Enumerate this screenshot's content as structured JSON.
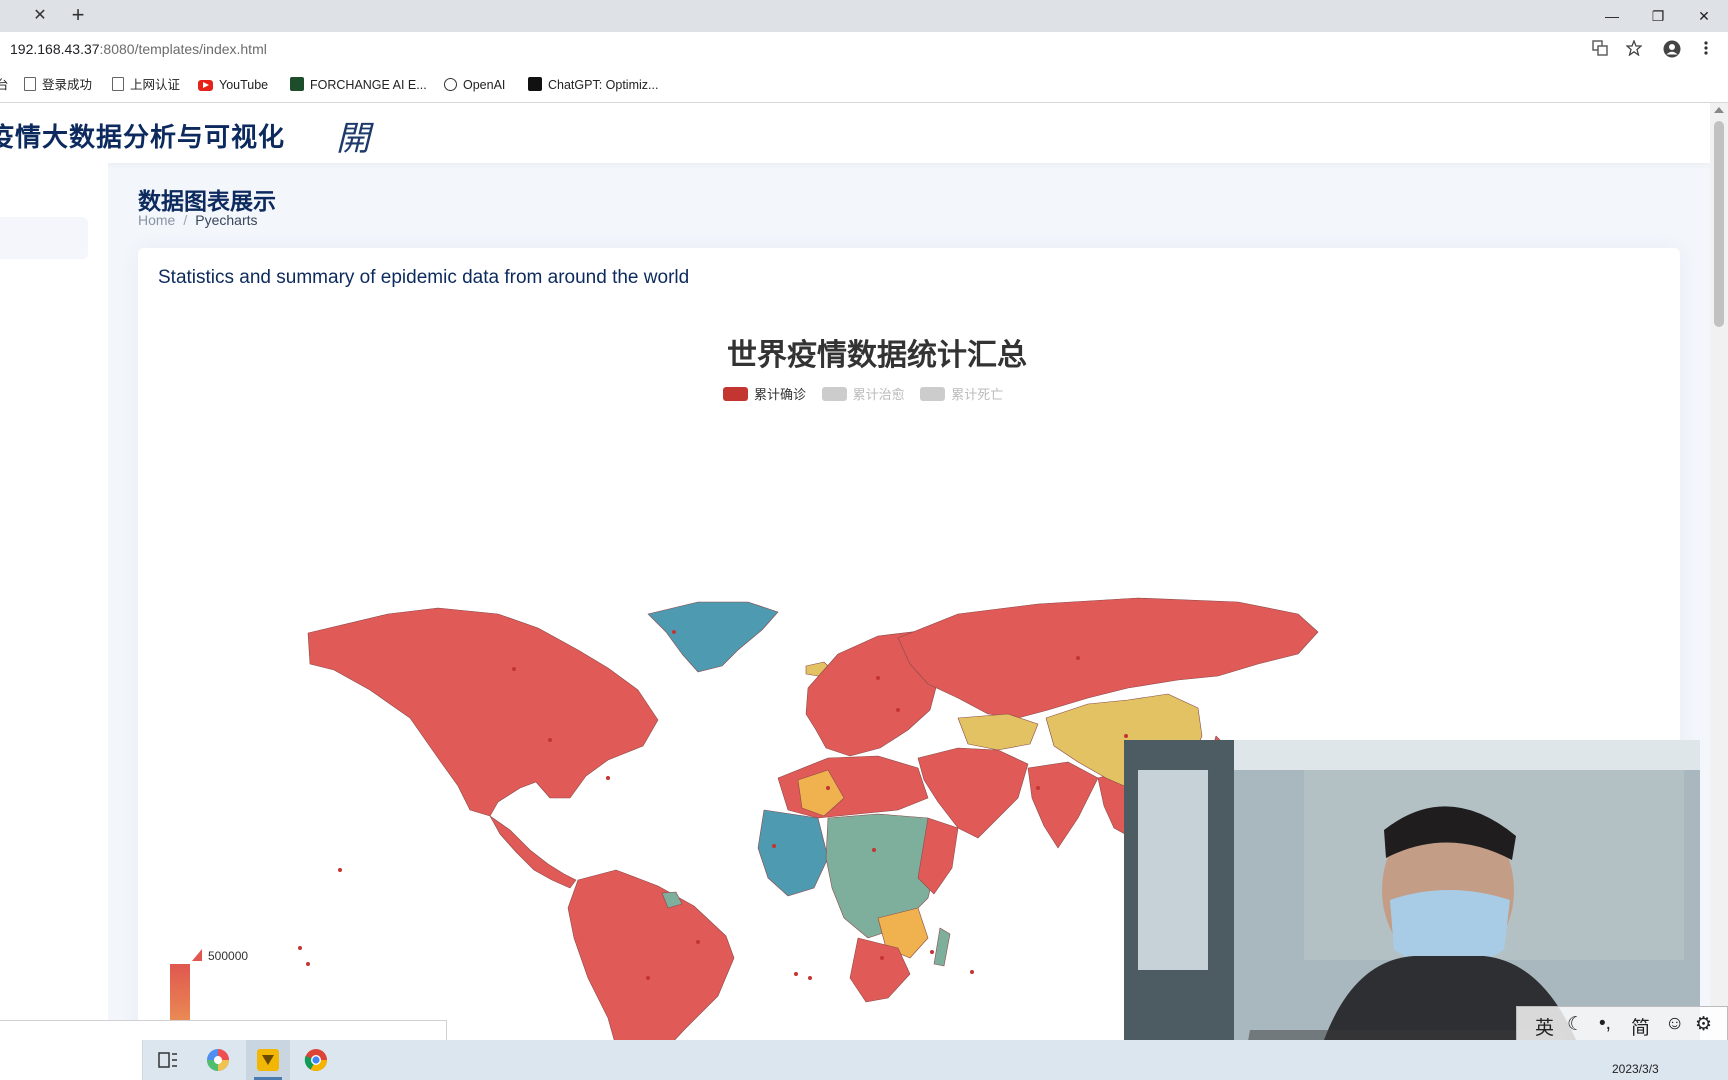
{
  "browser": {
    "tab_close": "✕",
    "new_tab": "+",
    "window_controls": [
      "—",
      "❐",
      "✕"
    ],
    "url_host": "192.168.43.37",
    "url_path": ":8080/templates/index.html",
    "bookmarks": [
      {
        "label": "登录成功",
        "icon": "page-icon"
      },
      {
        "label": "上网认证",
        "icon": "page-icon"
      },
      {
        "label": "YouTube",
        "icon": "youtube-icon"
      },
      {
        "label": "FORCHANGE AI E...",
        "icon": "forchange-icon"
      },
      {
        "label": "OpenAI",
        "icon": "openai-icon"
      },
      {
        "label": "ChatGPT: Optimiz...",
        "icon": "chatgpt-icon"
      }
    ]
  },
  "header": {
    "site_title": "疫情大数据分析与可视化",
    "menu_glyph": "開"
  },
  "page": {
    "title": "数据图表展示",
    "breadcrumb": [
      "Home",
      "/",
      "Pyecharts"
    ]
  },
  "card": {
    "title": "Statistics and summary of epidemic data from around the world"
  },
  "chart_data": {
    "type": "map",
    "title": "世界疫情数据统计汇总",
    "legend": [
      {
        "name": "累计确诊",
        "color": "#c23531",
        "active": true
      },
      {
        "name": "累计治愈",
        "color": "#cccccc",
        "active": false
      },
      {
        "name": "累计死亡",
        "color": "#cccccc",
        "active": false
      }
    ],
    "visual_map": {
      "max_label": "500000",
      "colors": [
        "#e0574f",
        "#f0a857"
      ]
    },
    "colors": {
      "high": "#e05a57",
      "mid_high": "#f0b24e",
      "mid": "#e2c262",
      "low": "#4e9ab0",
      "lower": "#7eae9c",
      "none": "#eeeeee"
    }
  },
  "webcam": {
    "label": "webcam-overlay"
  },
  "ime": {
    "items": [
      "英",
      "☾",
      "•,",
      "简",
      "☺",
      "⚙"
    ]
  },
  "taskbar": {
    "date": "2023/3/3"
  }
}
